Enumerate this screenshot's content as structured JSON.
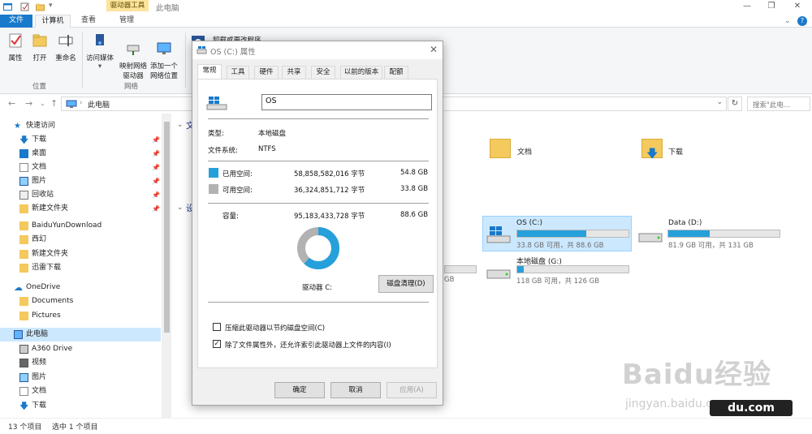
{
  "window": {
    "title": "此电脑",
    "context_tab_group": "驱动器工具",
    "controls": [
      "—",
      "❐",
      "✕"
    ]
  },
  "ribbon_tabs": [
    "文件",
    "计算机",
    "查看",
    "管理"
  ],
  "ribbon": {
    "location_group": {
      "label": "位置",
      "buttons": [
        "属性",
        "打开",
        "重命名"
      ]
    },
    "network_group": {
      "label": "网络",
      "buttons": [
        "访问媒体",
        "映射网络\n驱动器",
        "添加一个\n网络位置"
      ]
    },
    "system_group": {
      "visible_text": "卸载或更改程序"
    }
  },
  "address": {
    "path": "此电脑",
    "search_placeholder": "搜索\"此电..."
  },
  "nav_pane": {
    "quick_access": "快速访问",
    "items": [
      {
        "label": "下载",
        "pinned": true
      },
      {
        "label": "桌面",
        "pinned": true
      },
      {
        "label": "文档",
        "pinned": true
      },
      {
        "label": "图片",
        "pinned": true
      },
      {
        "label": "回收站",
        "pinned": true
      },
      {
        "label": "新建文件夹",
        "pinned": true
      },
      {
        "label": "BaiduYunDownload",
        "pinned": false
      },
      {
        "label": "西幻",
        "pinned": false
      },
      {
        "label": "新建文件夹",
        "pinned": false
      },
      {
        "label": "迅雷下载",
        "pinned": false
      }
    ],
    "onedrive": "OneDrive",
    "onedrive_items": [
      "Documents",
      "Pictures"
    ],
    "this_pc": "此电脑",
    "this_pc_items": [
      "A360 Drive",
      "视频",
      "图片",
      "文档",
      "下载"
    ]
  },
  "content": {
    "folders_section_partial": "文",
    "devices_section_partial": "设",
    "folders": [
      "文档",
      "下载"
    ],
    "drives": [
      {
        "name": "OS (C:)",
        "sub": "33.8 GB 可用，共 88.6 GB",
        "used_fraction": 0.62
      },
      {
        "name": "Data (D:)",
        "sub": "81.9 GB 可用，共 131 GB",
        "used_fraction": 0.37
      },
      {
        "name": "本地磁盘 (G:)",
        "sub": "118 GB 可用，共 126 GB",
        "used_fraction": 0.06
      }
    ],
    "partial_text_1": "GB",
    "partial_text_2": "GB"
  },
  "status": {
    "count": "13 个项目",
    "selection": "选中 1 个项目"
  },
  "dialog": {
    "title": "OS (C:) 属性",
    "tabs": [
      "常规",
      "工具",
      "硬件",
      "共享",
      "安全",
      "以前的版本",
      "配额"
    ],
    "active_tab": "常规",
    "name_value": "OS",
    "type_label": "类型:",
    "type_value": "本地磁盘",
    "fs_label": "文件系统:",
    "fs_value": "NTFS",
    "used_label": "已用空间:",
    "used_bytes": "58,858,582,016 字节",
    "used_gb": "54.8 GB",
    "free_label": "可用空间:",
    "free_bytes": "36,324,851,712 字节",
    "free_gb": "33.8 GB",
    "capacity_label": "容量:",
    "capacity_bytes": "95,183,433,728 字节",
    "capacity_gb": "88.6 GB",
    "used_fraction": 0.618,
    "drive_label": "驱动器 C:",
    "cleanup_button": "磁盘清理(D)",
    "compress_checkbox": "压缩此驱动器以节约磁盘空间(C)",
    "compress_checked": false,
    "index_checkbox": "除了文件属性外，还允许索引此驱动器上文件的内容(I)",
    "index_checked": true,
    "ok_button": "确定",
    "cancel_button": "取消",
    "apply_button": "应用(A)"
  },
  "colors": {
    "used": "#26a0da",
    "free": "#b2b2b2",
    "accent": "#1979ca"
  },
  "watermark": {
    "text": "Baidu经验",
    "url": "jingyan.baidu.com",
    "badge": "du.com"
  }
}
